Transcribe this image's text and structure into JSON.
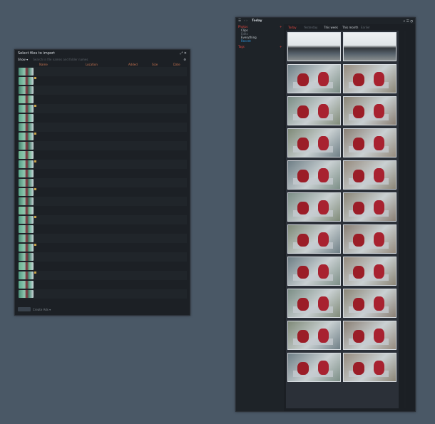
{
  "import_window": {
    "title": "Select files to import",
    "window_controls": "⤢ ✕",
    "show_label": "Show ▾",
    "search_hint": "Search in file names and folder names",
    "settings_icon": "gear-icon",
    "columns": [
      "Name",
      "Location",
      "Added",
      "Size",
      "Date"
    ],
    "rows_hint": "IMG_xxxx.JPG rows",
    "row_count": 30,
    "footer_label": "Create Ads ▾"
  },
  "main_window": {
    "title": "Today",
    "nav_arrows": "‹ ›",
    "top_icons": "⌕ ☰ ◔",
    "sidebar": {
      "sections": [
        {
          "label": "Photos",
          "color": "#e0463f"
        },
        {
          "label": "Clips",
          "color": "#c8ced3"
        },
        {
          "label": "Edits",
          "color": "#6f7780"
        },
        {
          "label": "Everything",
          "color": "#c8ced3"
        },
        {
          "label": "Recent",
          "color": "#2d9ce8"
        }
      ],
      "second_header": "Tags",
      "add_icon": "+"
    },
    "tabs": [
      "Today",
      "Yesterday",
      "This week",
      "This month",
      "Earlier"
    ],
    "accent": "#e0463f",
    "photo_count": 22
  }
}
